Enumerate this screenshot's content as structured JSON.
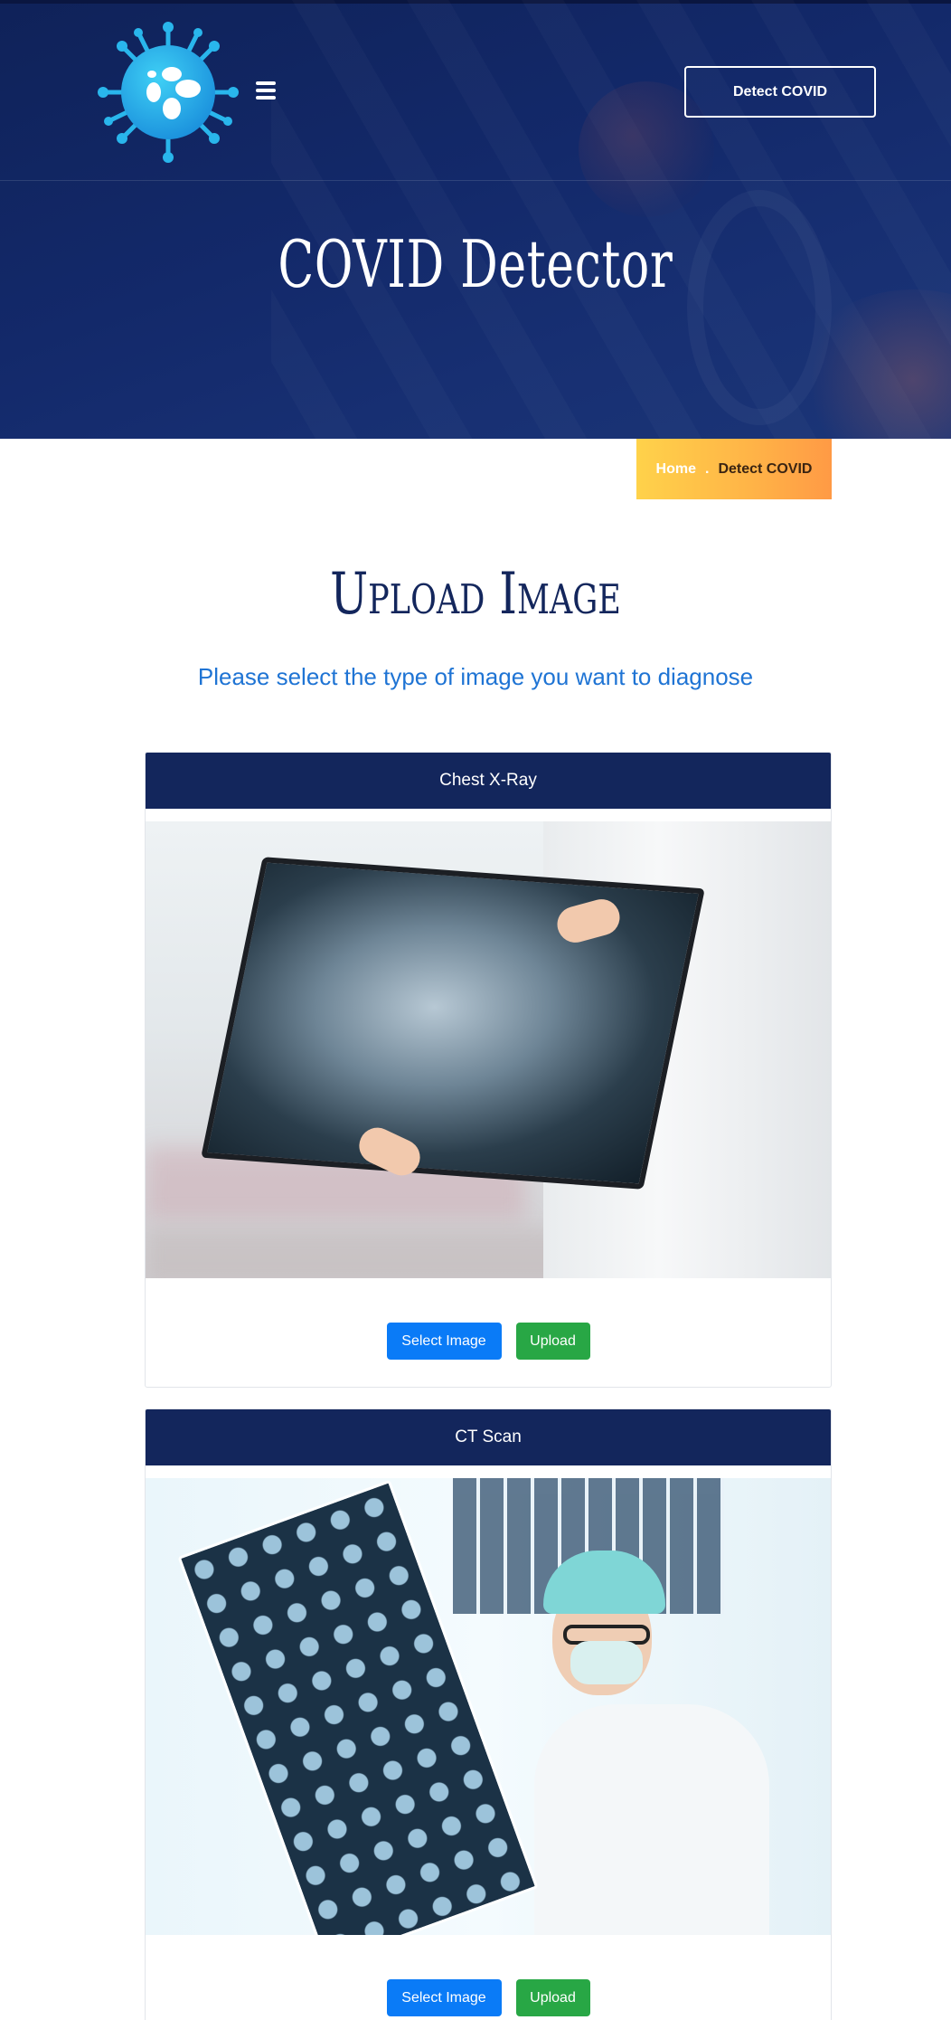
{
  "header": {
    "logo_icon": "virus-logo-icon",
    "menu_icon": "hamburger-menu-icon",
    "cta_label": "Detect COVID",
    "page_title": "COVID Detector"
  },
  "breadcrumb": {
    "home": "Home",
    "separator": ".",
    "current": "Detect COVID"
  },
  "main": {
    "title": "Upload Image",
    "subtitle": "Please select the type of image you want to diagnose",
    "cards": [
      {
        "title": "Chest X-Ray",
        "select_label": "Select Image",
        "upload_label": "Upload"
      },
      {
        "title": "CT Scan",
        "select_label": "Select Image",
        "upload_label": "Upload"
      }
    ]
  },
  "colors": {
    "navy": "#13265c",
    "primary_button": "#0a7bf7",
    "success_button": "#28a745",
    "subtitle_blue": "#1f74d4",
    "breadcrumb_gradient_start": "#ffd24a",
    "breadcrumb_gradient_end": "#ff9a45"
  }
}
